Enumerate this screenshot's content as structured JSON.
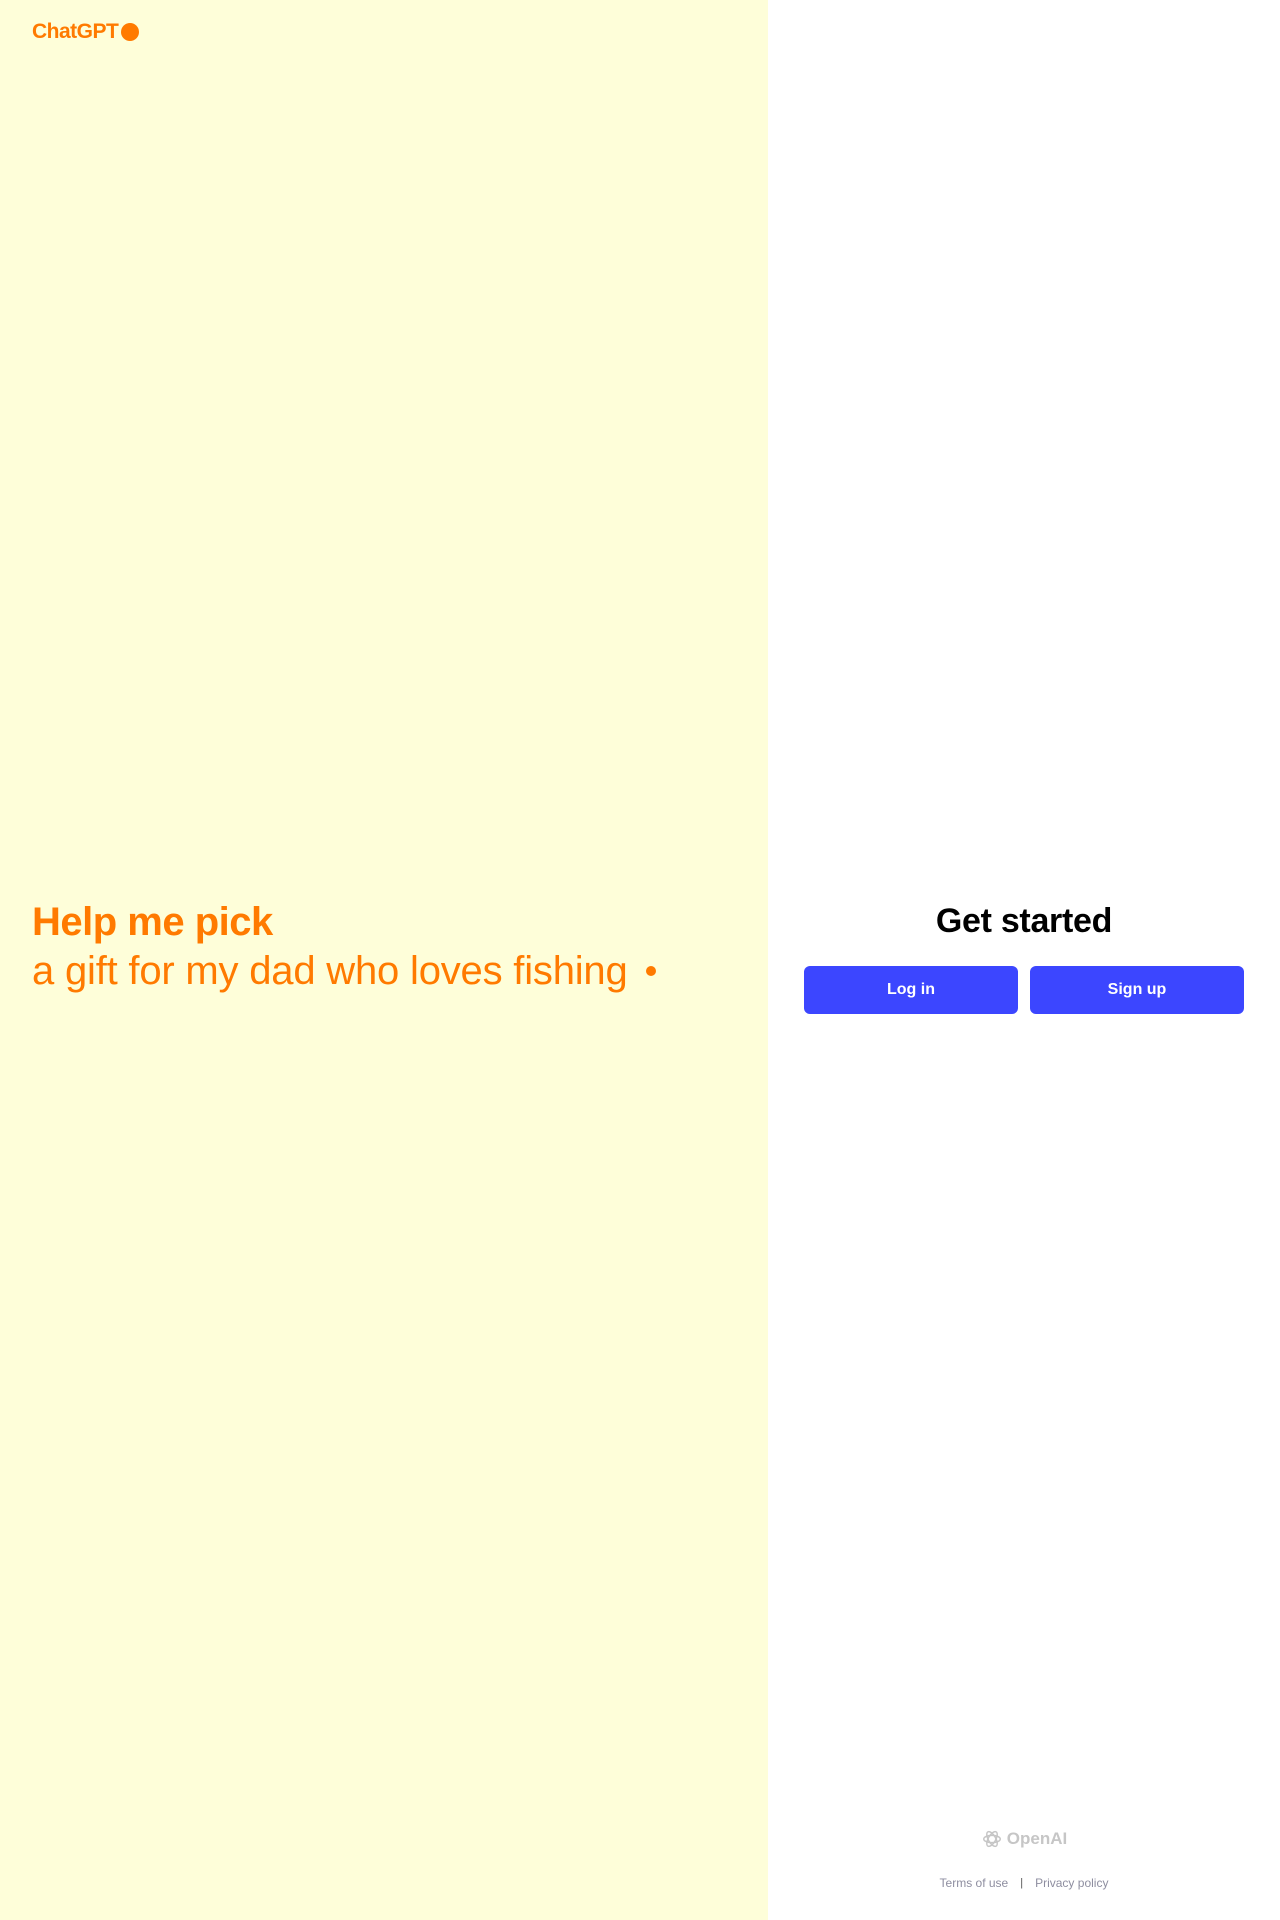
{
  "brand": {
    "name": "ChatGPT"
  },
  "hero": {
    "title": "Help me pick",
    "prompt": "a gift for my dad who loves fishing"
  },
  "auth": {
    "heading": "Get started",
    "login_label": "Log in",
    "signup_label": "Sign up"
  },
  "footer": {
    "logo_text": "OpenAI",
    "terms_label": "Terms of use",
    "separator": "|",
    "privacy_label": "Privacy policy"
  },
  "colors": {
    "left_bg": "#fefed9",
    "accent": "#ff7a00",
    "button": "#3c46ff"
  },
  "icons": [
    "openai-logo-icon"
  ]
}
